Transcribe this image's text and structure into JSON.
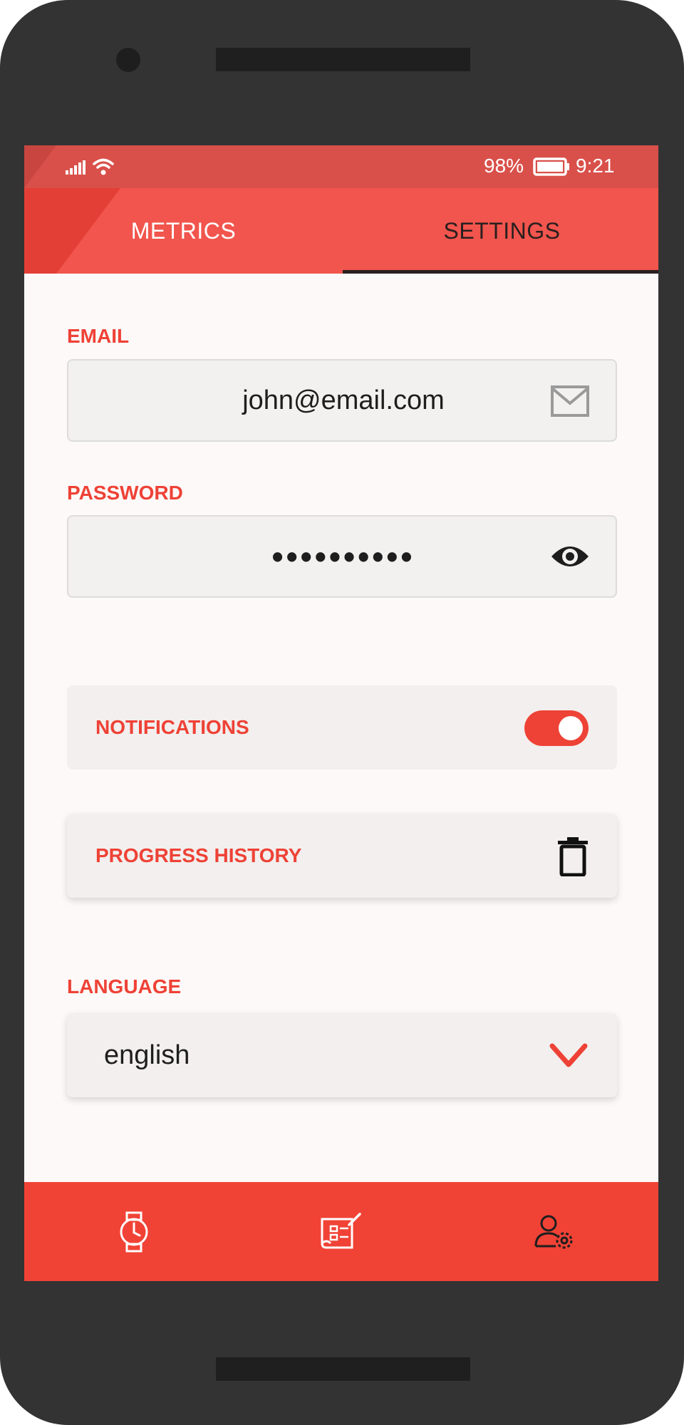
{
  "status_bar": {
    "battery_percent": "98%",
    "time": "9:21",
    "icons": [
      "signal-icon",
      "wifi-icon",
      "battery-icon"
    ]
  },
  "tabs": [
    {
      "label": "METRICS",
      "active": false
    },
    {
      "label": "SETTINGS",
      "active": true
    }
  ],
  "email": {
    "label": "EMAIL",
    "value": "john@email.com",
    "icon": "envelope-icon"
  },
  "password": {
    "label": "PASSWORD",
    "value": "••••••••••",
    "icon": "eye-icon"
  },
  "notifications": {
    "label": "NOTIFICATIONS",
    "enabled": true
  },
  "progress_history": {
    "label": "PROGRESS HISTORY",
    "icon": "trash-icon"
  },
  "language": {
    "label": "LANGUAGE",
    "value": "english",
    "icon": "chevron-down-icon"
  },
  "bottom_nav": [
    {
      "icon": "watch-icon"
    },
    {
      "icon": "workout-plan-icon"
    },
    {
      "icon": "user-settings-icon"
    }
  ],
  "colors": {
    "accent": "#ee4236",
    "header": "#f1554d",
    "status_bar": "#d9504a",
    "bottom_nav": "#f04336",
    "device": "#333333"
  }
}
